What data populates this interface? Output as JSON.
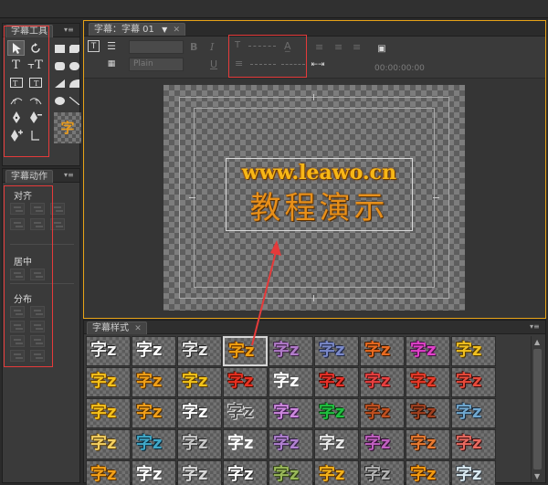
{
  "tools_panel": {
    "title": "字幕工具"
  },
  "actions_panel": {
    "title": "字幕动作",
    "sections": {
      "align": "对齐",
      "center": "居中",
      "distribute": "分布"
    }
  },
  "title_window": {
    "tab_label": "字幕：字幕 01",
    "font_style": "Plain",
    "timecode": "00:00:00:00",
    "canvas_line1": "www.leawo.cn",
    "canvas_line2": "教程演示"
  },
  "styles_panel": {
    "title": "字幕样式",
    "swatch_text": "字z",
    "swatches": [
      {
        "fg": "#f2f2f2",
        "sh": "#222"
      },
      {
        "fg": "#ffffff",
        "sh": "#333"
      },
      {
        "fg": "#e8e8e8",
        "sh": "#222"
      },
      {
        "fg": "#f0a010",
        "sh": "#5a2a00",
        "selected": true
      },
      {
        "fg": "#b07ac8",
        "sh": "#3a2040"
      },
      {
        "fg": "#7a88c8",
        "sh": "#202848"
      },
      {
        "fg": "#e86a20",
        "sh": "#3a1800"
      },
      {
        "fg": "#e040c8",
        "sh": "#401040"
      },
      {
        "fg": "#f0c020",
        "sh": "#503800"
      },
      {
        "fg": "#f6c21a",
        "sh": "#6a4000"
      },
      {
        "fg": "#f0a018",
        "sh": "#5a3000"
      },
      {
        "fg": "#f3c419",
        "sh": "#5a3a00"
      },
      {
        "fg": "#e83020",
        "sh": "#4a0a00"
      },
      {
        "fg": "#ffffff",
        "sh": "#555"
      },
      {
        "fg": "#e83028",
        "sh": "#3a0800"
      },
      {
        "fg": "#e84040",
        "sh": "#4a1010"
      },
      {
        "fg": "#e83a2a",
        "sh": "#5a1000"
      },
      {
        "fg": "#e84a3a",
        "sh": "#3a0a0a"
      },
      {
        "fg": "#f6c21a",
        "sh": "#6a4000"
      },
      {
        "fg": "#f2a01a",
        "sh": "#4a2a00"
      },
      {
        "fg": "#ffffff",
        "sh": "#333"
      },
      {
        "fg": "#4a4a4a",
        "sh": "#ddd"
      },
      {
        "fg": "#cc88dd",
        "sh": "#3a1a4a"
      },
      {
        "fg": "#20c040",
        "sh": "#0a3a10"
      },
      {
        "fg": "#c05020",
        "sh": "#3a1a0a"
      },
      {
        "fg": "#a04020",
        "sh": "#2a1208"
      },
      {
        "fg": "#70a8d0",
        "sh": "#1a2a3a"
      },
      {
        "fg": "#f4d060",
        "sh": "#5a4010"
      },
      {
        "fg": "#40a8c8",
        "sh": "#0a2a3a"
      },
      {
        "fg": "#c8c8c8",
        "sh": "#303030"
      },
      {
        "fg": "#ffffff",
        "sh": "#666"
      },
      {
        "fg": "#b080d0",
        "sh": "#302040"
      },
      {
        "fg": "#e8e8e8",
        "sh": "#404040"
      },
      {
        "fg": "#c060c0",
        "sh": "#301030"
      },
      {
        "fg": "#e87a30",
        "sh": "#3a1a08"
      },
      {
        "fg": "#e86a60",
        "sh": "#3a1010"
      },
      {
        "fg": "#f2a018",
        "sh": "#5a3000"
      },
      {
        "fg": "#ffffff",
        "sh": "#444"
      },
      {
        "fg": "#d8d8d8",
        "sh": "#383838"
      },
      {
        "fg": "#ffffff",
        "sh": "#222"
      },
      {
        "fg": "#9ab85a",
        "sh": "#2a3a10"
      },
      {
        "fg": "#f2b21a",
        "sh": "#5a3000"
      },
      {
        "fg": "#b0b0b0",
        "sh": "#202020"
      },
      {
        "fg": "#f29a10",
        "sh": "#4a2000"
      },
      {
        "fg": "#d8e8f0",
        "sh": "#303840"
      }
    ]
  }
}
